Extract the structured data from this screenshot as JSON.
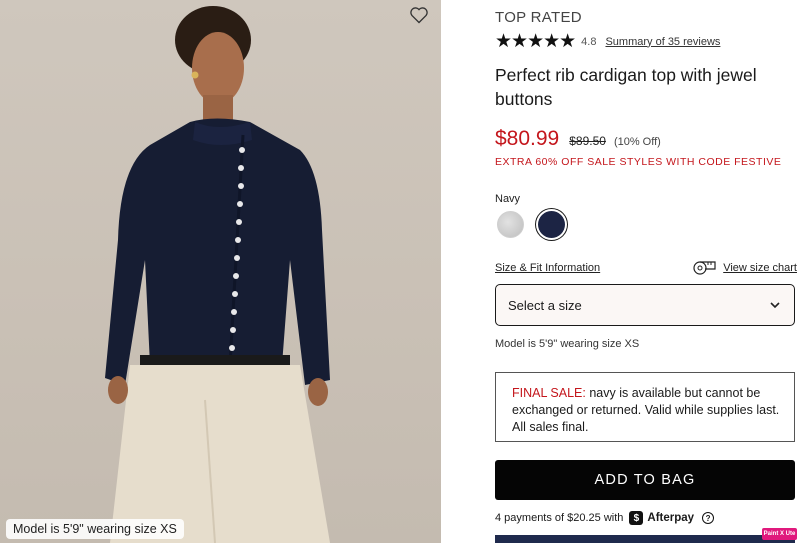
{
  "image": {
    "alt": "",
    "caption": "Model is 5'9\" wearing size XS"
  },
  "product": {
    "badge": "TOP RATED",
    "rating_value": "4.8",
    "stars": "★★★★★",
    "reviews_link": "Summary of 35 reviews",
    "title": "Perfect rib cardigan top with jewel buttons",
    "price": "$80.99",
    "original_price": "$89.50",
    "discount": "(10% Off)",
    "promo": "EXTRA 60% OFF SALE STYLES WITH CODE FESTIVE",
    "color_label": "Navy",
    "swatches": [
      {
        "name": "grey",
        "color": "#c8c8c8"
      },
      {
        "name": "navy",
        "color": "#1c2444",
        "selected": true
      }
    ],
    "size_fit_link": "Size & Fit Information",
    "size_chart_link": "View size chart",
    "size_select_placeholder": "Select a size",
    "model_note": "Model is 5'9\" wearing size XS",
    "final_sale_prefix": "FINAL SALE:",
    "final_sale_text": " navy is available but cannot be exchanged or returned. Valid while supplies last. All sales final.",
    "add_to_bag": "ADD TO BAG",
    "afterpay_text": "4 payments of $20.25 with",
    "afterpay_brand": "Afterpay",
    "badge_tool": "Paint X Ute"
  },
  "colors": {
    "sale_red": "#c4161c",
    "navy": "#1c2444",
    "button_black": "#050505"
  }
}
